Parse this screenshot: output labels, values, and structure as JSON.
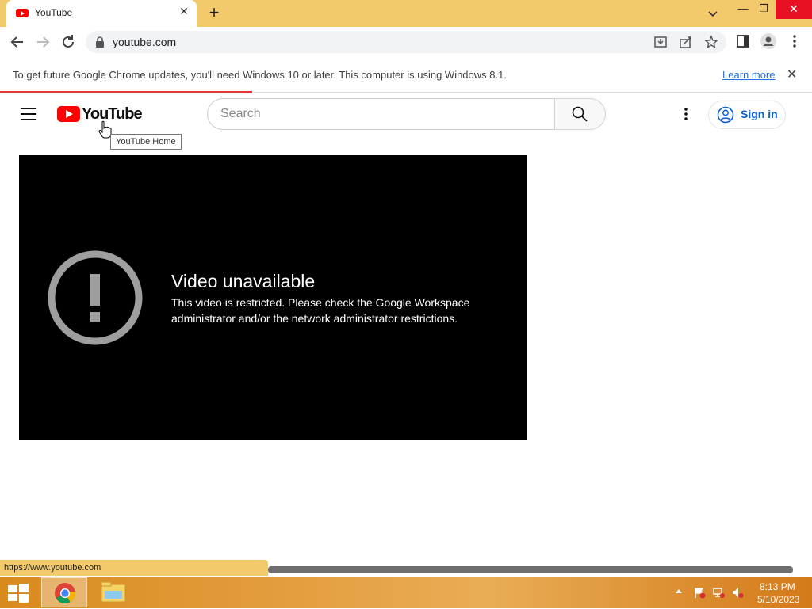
{
  "browser": {
    "tab_title": "YouTube",
    "url": "youtube.com",
    "infobar_text": "To get future Google Chrome updates, you'll need Windows 10 or later. This computer is using Windows 8.1.",
    "learn_more": "Learn more",
    "status_url": "https://www.youtube.com"
  },
  "youtube": {
    "logo_text": "YouTube",
    "tooltip": "YouTube Home",
    "search_placeholder": "Search",
    "signin_label": "Sign in",
    "video_title": "Video unavailable",
    "video_message": "This video is restricted. Please check the Google Workspace administrator and/or the network administrator restrictions."
  },
  "taskbar": {
    "time": "8:13 PM",
    "date": "5/10/2023"
  },
  "colors": {
    "titlebar": "#f2c96b",
    "youtube_red": "#ff0000",
    "link_blue": "#065fd4",
    "taskbar": "#e5a043"
  },
  "icons": [
    "youtube-favicon-icon",
    "close-icon",
    "plus-icon",
    "chevron-down-icon",
    "back-arrow-icon",
    "forward-arrow-icon",
    "reload-icon",
    "lock-icon",
    "install-icon",
    "share-icon",
    "star-icon",
    "side-panel-icon",
    "profile-icon",
    "more-vert-icon",
    "hamburger-icon",
    "search-icon",
    "account-circle-icon",
    "exclamation-circle-icon",
    "windows-start-icon",
    "chrome-icon",
    "file-explorer-icon"
  ]
}
